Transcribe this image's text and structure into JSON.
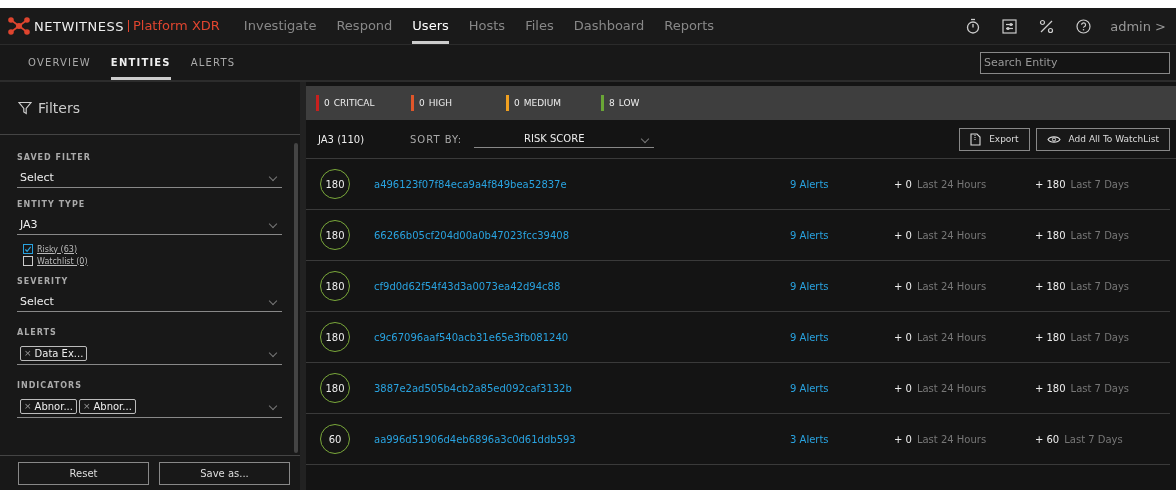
{
  "brand": {
    "name": "NETWITNESS",
    "product": "Platform XDR"
  },
  "nav": [
    {
      "label": "Investigate",
      "selected": false
    },
    {
      "label": "Respond",
      "selected": false
    },
    {
      "label": "Users",
      "selected": true
    },
    {
      "label": "Hosts",
      "selected": false
    },
    {
      "label": "Files",
      "selected": false
    },
    {
      "label": "Dashboard",
      "selected": false
    },
    {
      "label": "Reports",
      "selected": false
    }
  ],
  "user": "admin >",
  "subtabs": [
    {
      "label": "OVERVIEW",
      "selected": false
    },
    {
      "label": "ENTITIES",
      "selected": true
    },
    {
      "label": "ALERTS",
      "selected": false
    }
  ],
  "search": {
    "placeholder": "Search Entity"
  },
  "filters": {
    "title": "Filters",
    "saved_filter": {
      "label": "SAVED FILTER",
      "value": "Select"
    },
    "entity_type": {
      "label": "ENTITY TYPE",
      "value": "JA3"
    },
    "checks": [
      {
        "label": "Risky (63)",
        "checked": true
      },
      {
        "label": "Watchlist (0)",
        "checked": false
      }
    ],
    "severity": {
      "label": "SEVERITY",
      "value": "Select"
    },
    "alerts": {
      "label": "ALERTS",
      "tags": [
        {
          "remove": "×",
          "label": "Data Ex..."
        }
      ]
    },
    "indicators": {
      "label": "INDICATORS",
      "tags": [
        {
          "remove": "×",
          "label": "Abnor..."
        },
        {
          "remove": "×",
          "label": "Abnor..."
        }
      ]
    },
    "buttons": [
      "Reset",
      "Save as..."
    ]
  },
  "severity_counts": [
    {
      "count": "0",
      "label": "CRITICAL",
      "color": "#c8201e"
    },
    {
      "count": "0",
      "label": "HIGH",
      "color": "#e0562a"
    },
    {
      "count": "0",
      "label": "MEDIUM",
      "color": "#f0a020"
    },
    {
      "count": "8",
      "label": "LOW",
      "color": "#6aa536"
    }
  ],
  "list": {
    "title": "JA3 (110)",
    "sort_label": "SORT BY:",
    "sort_value": "RISK SCORE",
    "buttons": [
      "Export",
      "Add All To WatchList"
    ],
    "rows": [
      {
        "score": "180",
        "id": "a496123f07f84eca9a4f849bea52837e",
        "alerts": "9 Alerts",
        "day_delta": "+ 0",
        "day_label": "Last 24 Hours",
        "week_delta": "+ 180",
        "week_label": "Last 7 Days"
      },
      {
        "score": "180",
        "id": "66266b05cf204d00a0b47023fcc39408",
        "alerts": "9 Alerts",
        "day_delta": "+ 0",
        "day_label": "Last 24 Hours",
        "week_delta": "+ 180",
        "week_label": "Last 7 Days"
      },
      {
        "score": "180",
        "id": "cf9d0d62f54f43d3a0073ea42d94c88",
        "alerts": "9 Alerts",
        "day_delta": "+ 0",
        "day_label": "Last 24 Hours",
        "week_delta": "+ 180",
        "week_label": "Last 7 Days"
      },
      {
        "score": "180",
        "id": "c9c67096aaf540acb31e65e3fb081240",
        "alerts": "9 Alerts",
        "day_delta": "+ 0",
        "day_label": "Last 24 Hours",
        "week_delta": "+ 180",
        "week_label": "Last 7 Days"
      },
      {
        "score": "180",
        "id": "3887e2ad505b4cb2a85ed092caf3132b",
        "alerts": "9 Alerts",
        "day_delta": "+ 0",
        "day_label": "Last 24 Hours",
        "week_delta": "+ 180",
        "week_label": "Last 7 Days"
      },
      {
        "score": "60",
        "id": "aa996d51906d4eb6896a3c0d61ddb593",
        "alerts": "3 Alerts",
        "day_delta": "+ 0",
        "day_label": "Last 24 Hours",
        "week_delta": "+ 60",
        "week_label": "Last 7 Days"
      }
    ]
  }
}
